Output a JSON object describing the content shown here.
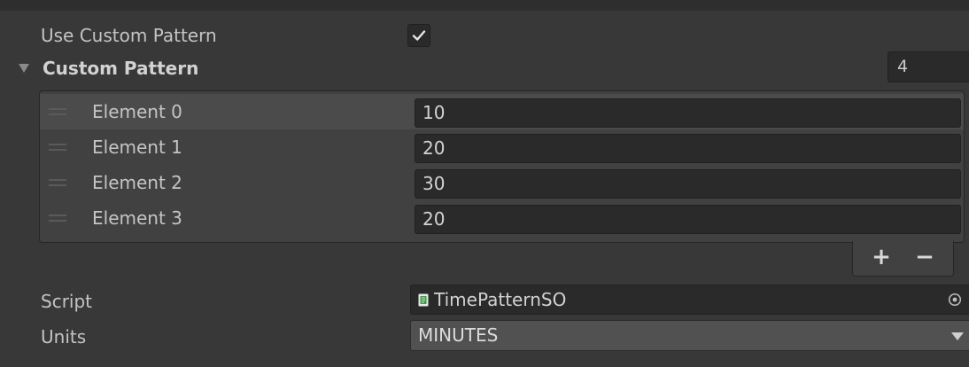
{
  "use_custom_pattern": {
    "label": "Use Custom Pattern",
    "checked": true
  },
  "custom_pattern": {
    "title": "Custom Pattern",
    "size": "4",
    "elements": [
      {
        "label": "Element 0",
        "value": "10"
      },
      {
        "label": "Element 1",
        "value": "20"
      },
      {
        "label": "Element 2",
        "value": "30"
      },
      {
        "label": "Element 3",
        "value": "20"
      }
    ],
    "add_label": "+",
    "remove_label": "−"
  },
  "script": {
    "label": "Script",
    "value": "TimePatternSO",
    "icon": "script-file-icon"
  },
  "units": {
    "label": "Units",
    "value": "MINUTES"
  },
  "colors": {
    "background": "#383838",
    "field": "#2a2a2a",
    "text": "#c4c4c4"
  }
}
